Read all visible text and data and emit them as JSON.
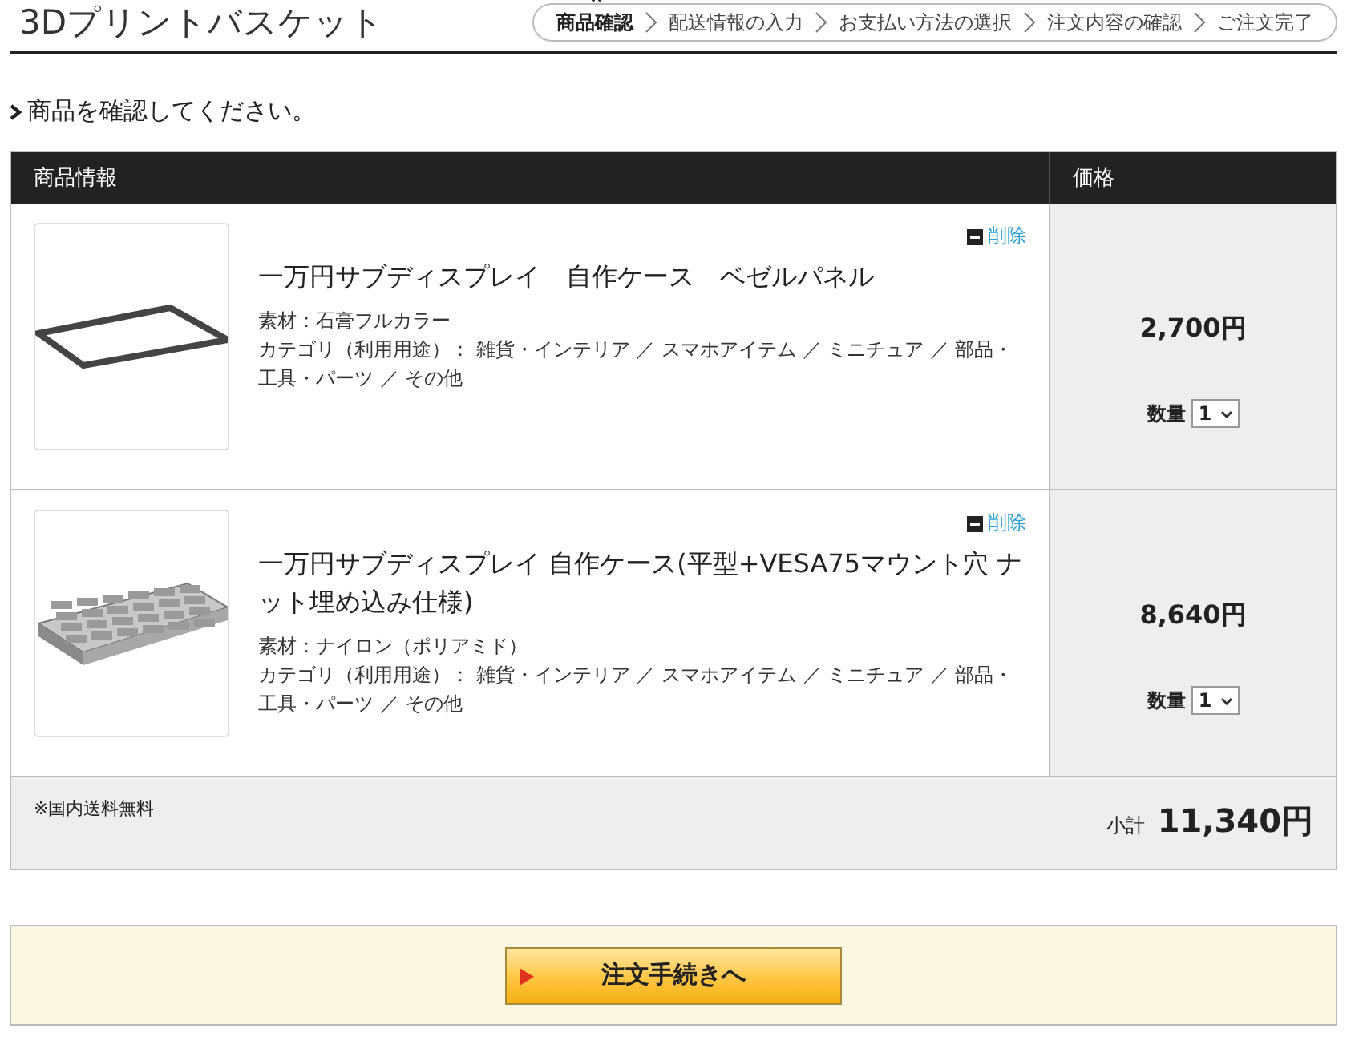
{
  "title": "3Dプリントバスケット",
  "steps": [
    {
      "label": "商品確認",
      "selected": true
    },
    {
      "label": "配送情報の入力",
      "selected": false
    },
    {
      "label": "お支払い方法の選択",
      "selected": false
    },
    {
      "label": "注文内容の確認",
      "selected": false
    },
    {
      "label": "ご注文完了",
      "selected": false
    }
  ],
  "message": "商品を確認してください。",
  "table": {
    "columns": [
      "商品情報",
      "価格"
    ],
    "rows": [
      {
        "kind": "frame",
        "delete": "削除",
        "name": "一万円サブディスプレイ　自作ケース　ベゼルパネル",
        "material": "素材：石膏フルカラー",
        "category": "カテゴリ（利用用途）： 雑貨・インテリア ／ スマホアイテム ／ ミニチュア ／ 部品・工具・パーツ ／ その他",
        "price": "2,700円",
        "qty_label": "数量",
        "qty": "1"
      },
      {
        "kind": "tray",
        "delete": "削除",
        "name": "一万円サブディスプレイ 自作ケース(平型+VESA75マウント穴 ナット埋め込み仕様)",
        "material": "素材：ナイロン（ポリアミド）",
        "category": "カテゴリ（利用用途）： 雑貨・インテリア ／ スマホアイテム ／ ミニチュア ／ 部品・工具・パーツ ／ その他",
        "price": "8,640円",
        "qty_label": "数量",
        "qty": "1"
      }
    ],
    "note": "※国内送料無料",
    "subtotal_label": "小計",
    "subtotal": "11,340円"
  },
  "checkout_button": "注文手続きへ"
}
